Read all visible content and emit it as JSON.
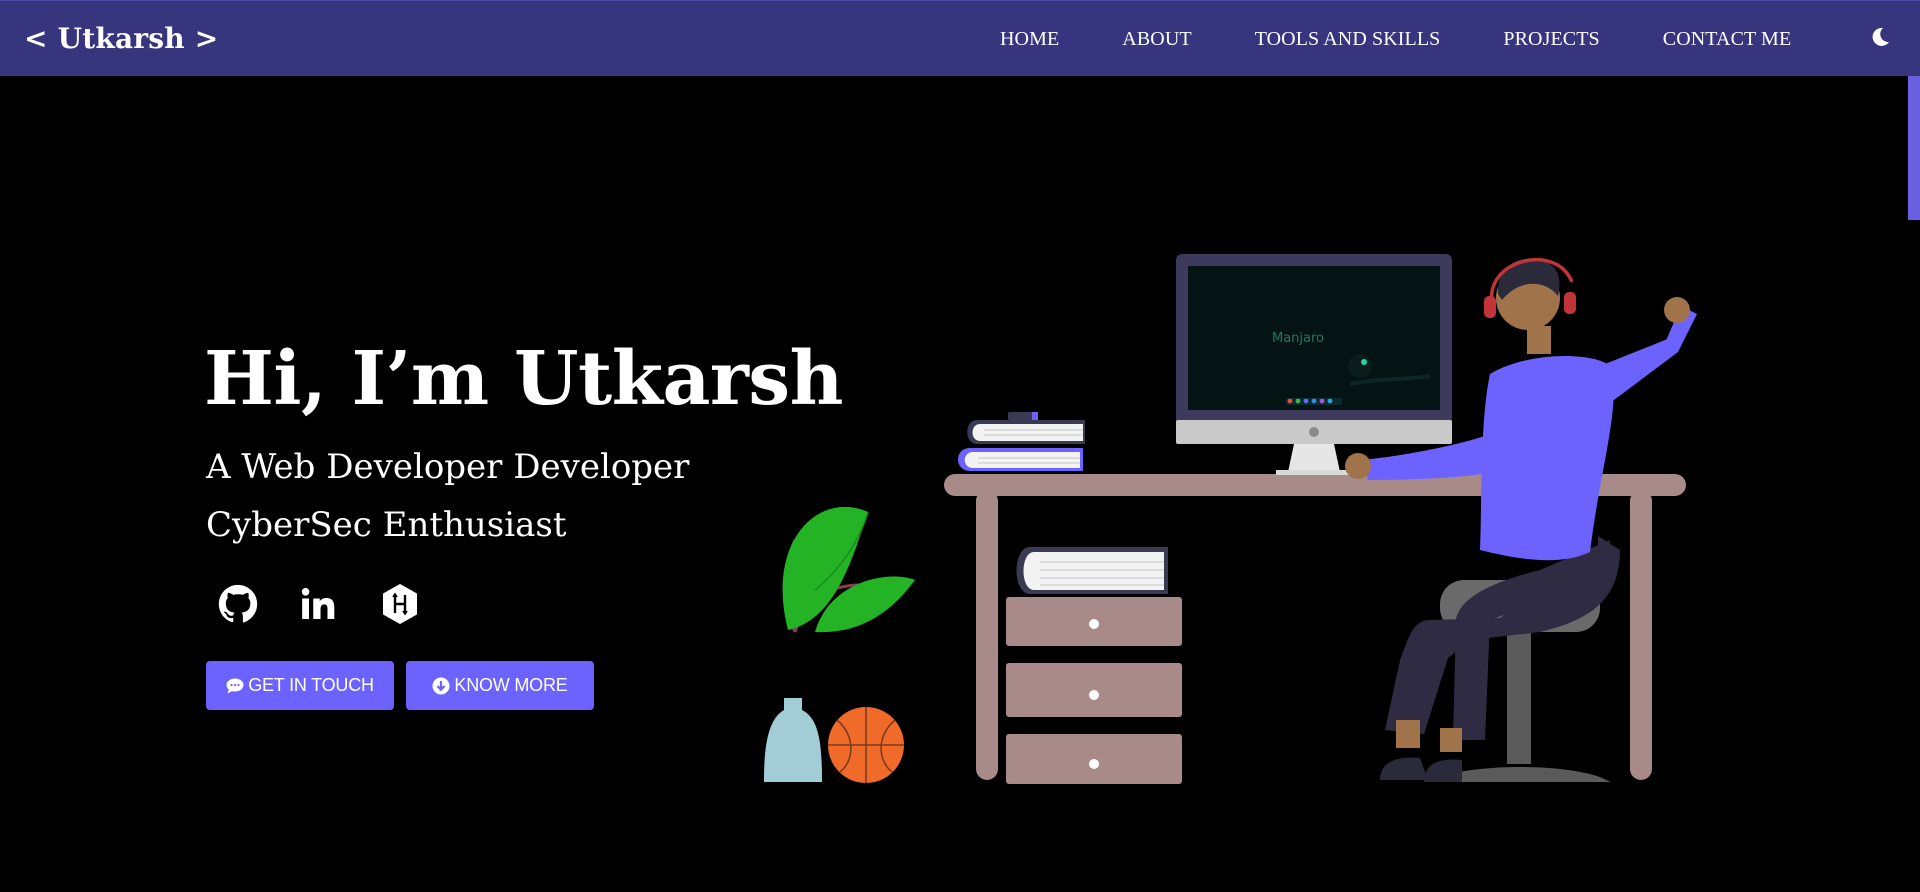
{
  "nav": {
    "brand": "< Utkarsh >",
    "links": [
      "HOME",
      "ABOUT",
      "TOOLS AND SKILLS",
      "PROJECTS",
      "CONTACT ME"
    ],
    "theme_icon": "moon-icon"
  },
  "hero": {
    "title": "Hi, I’m Utkarsh",
    "subtitle_line1": "A Web Developer Developer",
    "subtitle_line2": "CyberSec Enthusiast",
    "socials": [
      {
        "name": "github",
        "icon": "github-icon"
      },
      {
        "name": "linkedin",
        "icon": "linkedin-icon"
      },
      {
        "name": "hackerrank",
        "icon": "hackerrank-icon"
      }
    ],
    "buttons": {
      "get_in_touch": "GET IN TOUCH",
      "know_more": "KNOW MORE"
    }
  },
  "illustration": {
    "screen_text": "Manjaro"
  },
  "colors": {
    "navbar": "#37357e",
    "accent": "#6c63ff",
    "background": "#000000"
  }
}
